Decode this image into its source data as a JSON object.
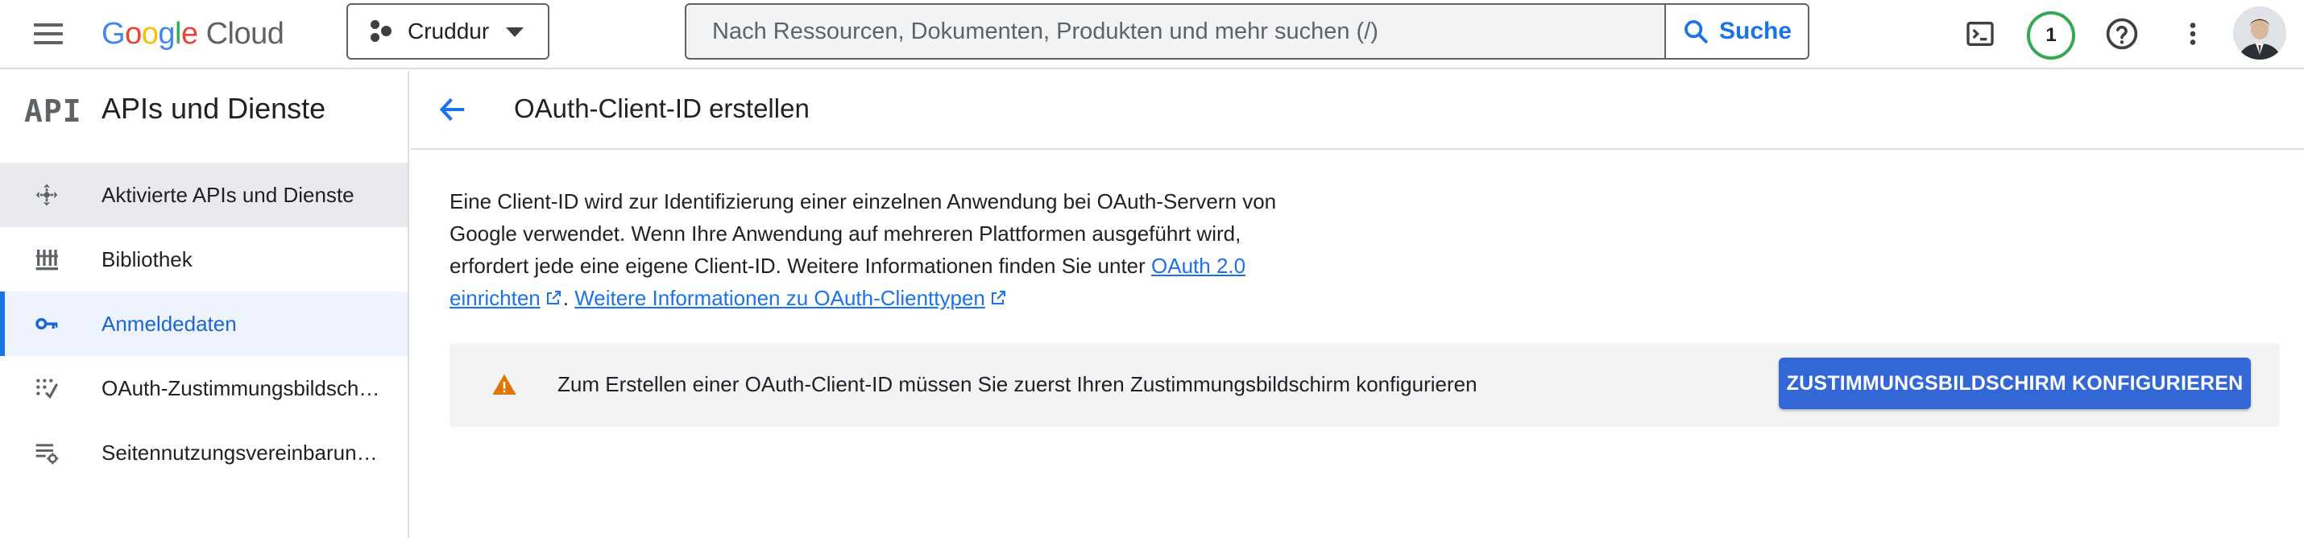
{
  "topbar": {
    "logo": {
      "google": "Google",
      "cloud": "Cloud"
    },
    "project": "Cruddur",
    "search": {
      "placeholder": "Nach Ressourcen, Dokumenten, Produkten und mehr suchen (/)",
      "value": "",
      "button_label": "Suche"
    },
    "notification_count": "1",
    "icons": [
      "menu-icon",
      "terminal-icon",
      "help-icon",
      "more-vert-icon",
      "avatar"
    ]
  },
  "sidebar": {
    "logo_text": "API",
    "title": "APIs und Dienste",
    "items": [
      {
        "label": "Aktivierte APIs und Dienste",
        "icon": "apis-icon",
        "state": "hover"
      },
      {
        "label": "Bibliothek",
        "icon": "library-icon",
        "state": "normal"
      },
      {
        "label": "Anmeldedaten",
        "icon": "key-icon",
        "state": "selected"
      },
      {
        "label": "OAuth-Zustimmungsbildschirm",
        "icon": "consent-icon",
        "state": "normal"
      },
      {
        "label": "Seitennutzungsvereinbarungen",
        "icon": "settings-list-icon",
        "state": "normal"
      }
    ]
  },
  "main": {
    "title": "OAuth-Client-ID erstellen",
    "intro_text": "Eine Client-ID wird zur Identifizierung einer einzelnen Anwendung bei OAuth-Servern von Google verwendet. Wenn Ihre Anwendung auf mehreren Plattformen ausgeführt wird, erfordert jede eine eigene Client-ID. Weitere Informationen finden Sie unter ",
    "link1": "OAuth 2.0 einrichten",
    "separator": ". ",
    "link2": "Weitere Informationen zu OAuth-Clienttypen",
    "banner_text": "Zum Erstellen einer OAuth-Client-ID müssen Sie zuerst Ihren Zustimmungsbildschirm konfigurieren",
    "banner_button": "ZUSTIMMUNGSBILDSCHIRM KONFIGURIEREN"
  },
  "colors": {
    "accent": "#1a73e8",
    "button": "#3367d6",
    "warning": "#e37400",
    "notification_ring": "#34a853"
  }
}
